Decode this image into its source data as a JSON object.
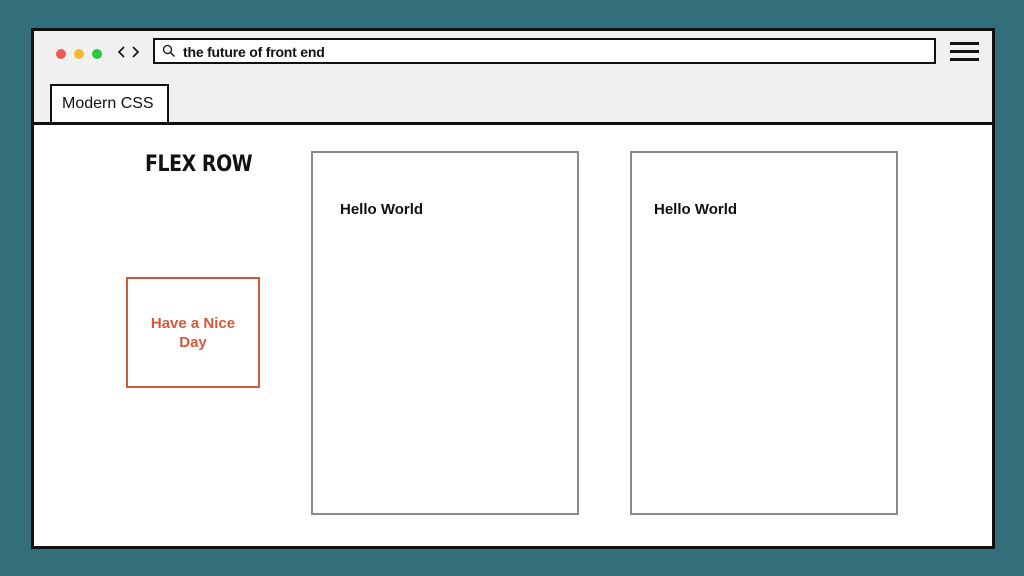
{
  "browser": {
    "address": "the future of front end",
    "tab_label": "Modern CSS",
    "icons": {
      "back": "chevron-left-icon",
      "forward": "chevron-right-icon",
      "search": "search-icon",
      "menu": "hamburger-menu-icon"
    }
  },
  "content": {
    "title": "FLEX ROW",
    "nice_box": "Have a Nice Day",
    "cards": [
      {
        "text": "Hello World"
      },
      {
        "text": "Hello World"
      }
    ]
  },
  "colors": {
    "background": "#336e7b",
    "accent": "#d4583a",
    "card_border": "#8a8a8a",
    "traffic_red": "#ef5a52",
    "traffic_yellow": "#f5b82e",
    "traffic_green": "#2bc840"
  }
}
